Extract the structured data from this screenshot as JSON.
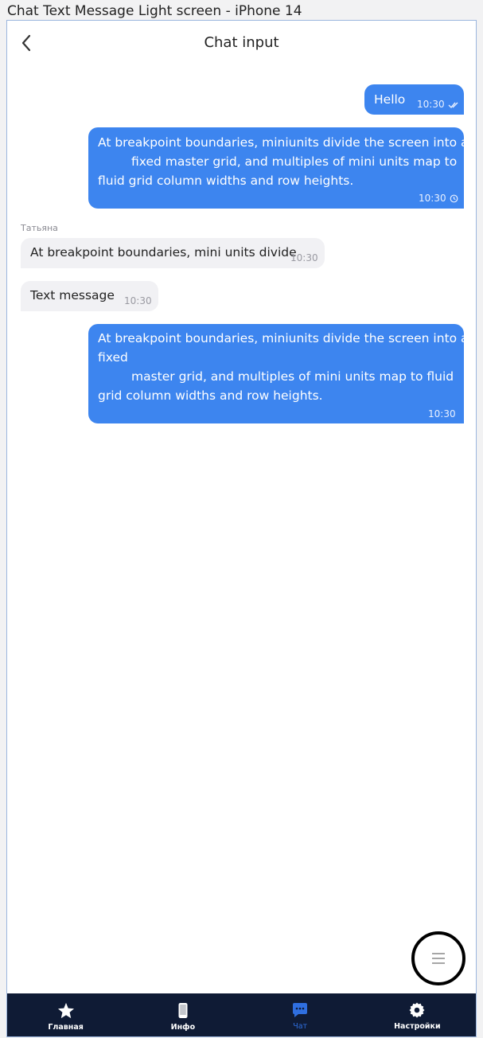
{
  "frame_title": "Chat Text Message Light screen - iPhone 14",
  "header": {
    "title": "Chat input"
  },
  "messages": [
    {
      "text": "Hello",
      "time": "10:30",
      "status": "double-check-icon"
    },
    {
      "lines": [
        "At breakpoint boundaries, miniunits divide the screen into a",
        "fixed master grid, and multiples of mini units map to",
        "fluid grid column widths and row heights."
      ],
      "time": "10:30",
      "status": "clock-icon"
    },
    {
      "sender": "Татьяна",
      "text": "At breakpoint boundaries, mini units divide",
      "time": "10:30"
    },
    {
      "text": "Text message",
      "time": "10:30"
    },
    {
      "lines": [
        "At breakpoint boundaries, miniunits divide the screen into a",
        "fixed",
        "master grid, and multiples of mini units map to fluid",
        "grid column widths and row heights."
      ],
      "time": "10:30"
    }
  ],
  "fab": {
    "icon": "menu-icon"
  },
  "tabs": [
    {
      "label": "Главная",
      "icon": "star-icon",
      "active": false
    },
    {
      "label": "Инфо",
      "icon": "phone-icon",
      "active": false
    },
    {
      "label": "Чат",
      "icon": "chat-icon",
      "active": true
    },
    {
      "label": "Настройки",
      "icon": "gear-icon",
      "active": false
    }
  ],
  "colors": {
    "accent": "#3d85ef",
    "tab_bar": "#0f1b35",
    "active_tab": "#2f6fe0",
    "incoming_bubble": "#f1f1f4"
  }
}
